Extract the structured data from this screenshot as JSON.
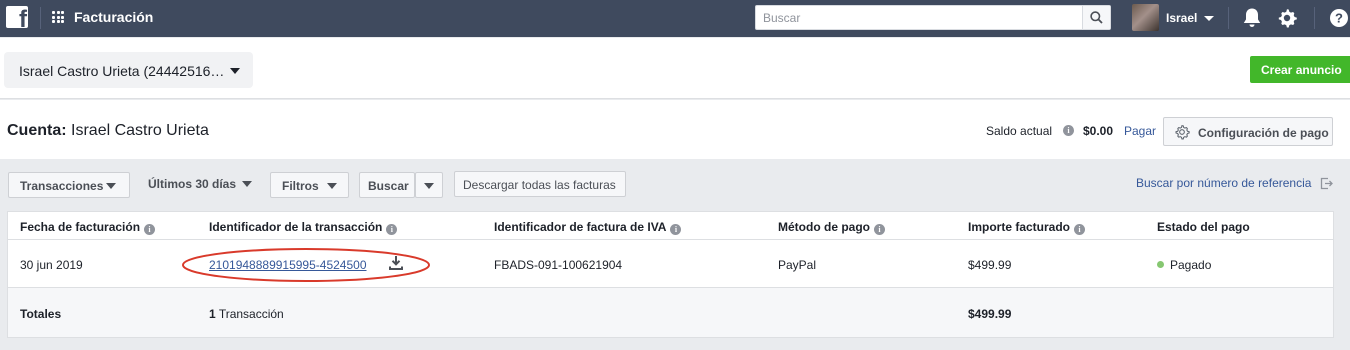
{
  "topbar": {
    "logo_icon": "facebook-logo-icon",
    "apps_icon": "apps-grid-icon",
    "title": "Facturación",
    "search_placeholder": "Buscar",
    "search_icon": "magnifier-icon",
    "user_name": "Israel",
    "notifications_icon": "bell-icon",
    "settings_icon": "gear-icon",
    "help_icon": "question-icon",
    "background_color": "#3f4a5e"
  },
  "header": {
    "account_selector": "Israel Castro Urieta (24442516…",
    "create_ad_button": "Crear anuncio",
    "create_ad_color": "#42b72a"
  },
  "account": {
    "label": "Cuenta:",
    "name": "Israel Castro Urieta",
    "balance_label": "Saldo actual",
    "balance_value": "$0.00",
    "pay_link": "Pagar",
    "payment_settings_button": "Configuración de pago"
  },
  "toolbar": {
    "transactions_dropdown": "Transacciones",
    "date_range_dropdown": "Últimos 30 días",
    "filters_dropdown": "Filtros",
    "search_button": "Buscar",
    "download_all_button": "Descargar todas las facturas",
    "reference_search_link": "Buscar por número de referencia"
  },
  "table": {
    "columns": [
      "Fecha de facturación",
      "Identificador de la transacción",
      "Identificador de factura de IVA",
      "Método de pago",
      "Importe facturado",
      "Estado del pago"
    ],
    "rows": [
      {
        "date": "30 jun 2019",
        "transaction_id": "2101948889915995-4524500",
        "vat_invoice_id": "FBADS-091-100621904",
        "payment_method": "PayPal",
        "amount": "$499.99",
        "status": "Pagado",
        "status_color": "#86c771"
      }
    ],
    "totals": {
      "label": "Totales",
      "count": "1",
      "count_label": "Transacción",
      "amount": "$499.99"
    },
    "highlight_color": "#d93a2b"
  }
}
